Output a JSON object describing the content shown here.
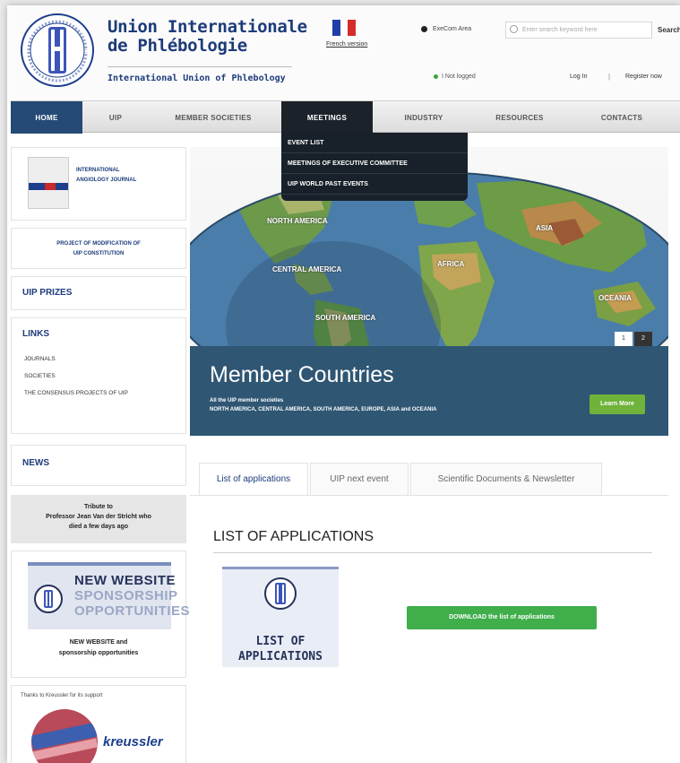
{
  "header": {
    "title_line1": "Union Internationale",
    "title_line2": "de Phlébologie",
    "title_line3": "International Union of Phlebology",
    "french_version": "French version",
    "area_label": "ExeCom Area",
    "search_placeholder": "Enter search keyword here",
    "search_button": "Search",
    "logged_status": "I Not logged",
    "login": "Log In",
    "separator": "|",
    "register": "Register now"
  },
  "nav": {
    "items": [
      "HOME",
      "UIP",
      "MEMBER SOCIETIES",
      "MEETINGS",
      "INDUSTRY",
      "RESOURCES",
      "CONTACTS"
    ],
    "active": "HOME",
    "open_menu": "MEETINGS"
  },
  "dropdown": {
    "items": [
      "EVENT LIST",
      "MEETINGS OF EXECUTIVE COMMITTEE",
      "UIP WORLD PAST EVENTS"
    ]
  },
  "sidebar": {
    "journal_label_line1": "INTERNATIONAL",
    "journal_label_line2": "ANGIOLOGY JOURNAL",
    "project_line1": "PROJECT OF MODIFICATION OF",
    "project_line2": "UIP CONSTITUTION",
    "prizes_title": "UIP PRIZES",
    "links_title": "LINKS",
    "links": [
      "JOURNALS",
      "SOCIETIES",
      "THE CONSENSUS PROJECTS OF UIP"
    ],
    "news_title": "NEWS",
    "tribute_line1": "Tribute to",
    "tribute_line2": "Professor Jean Van der Stricht who",
    "tribute_line3": "died a few days ago",
    "sponsor_img_line1": "NEW WEBSITE",
    "sponsor_img_line2": "SPONSORSHIP",
    "sponsor_img_line3": "OPPORTUNITIES",
    "sponsor_cap_line1": "NEW WEBSITE and",
    "sponsor_cap_line2": "sponsorship opportunities",
    "thanks_text": "Thanks to Kreussler for its support",
    "kreussler_logo": "kreussler"
  },
  "hero": {
    "map_labels": [
      "NORTH AMERICA",
      "CENTRAL AMERICA",
      "SOUTH AMERICA",
      "AFRICA",
      "ASIA",
      "OCEANIA"
    ],
    "title": "Member Countries",
    "sub_line1": "All the UIP member societies",
    "sub_line2": "NORTH AMERICA, CENTRAL AMERICA, SOUTH AMERICA, EUROPE, ASIA and OCEANIA",
    "learn_more": "Learn More",
    "pager": [
      "1",
      "2"
    ]
  },
  "tabs": {
    "items": [
      "List of applications",
      "UIP next event",
      "Scientific Documents & Newsletter"
    ],
    "active": "List of applications"
  },
  "applications": {
    "title": "LIST OF APPLICATIONS",
    "img_line1": "LIST OF",
    "img_line2": "APPLICATIONS",
    "download": "DOWNLOAD the list of applications"
  },
  "colors": {
    "brand_blue": "#1c3b7a",
    "nav_active": "#244a75",
    "dropdown_bg": "#18212a",
    "hero_band": "#2f5673",
    "learn_green": "#6fb33a",
    "download_green": "#3fae4b"
  }
}
